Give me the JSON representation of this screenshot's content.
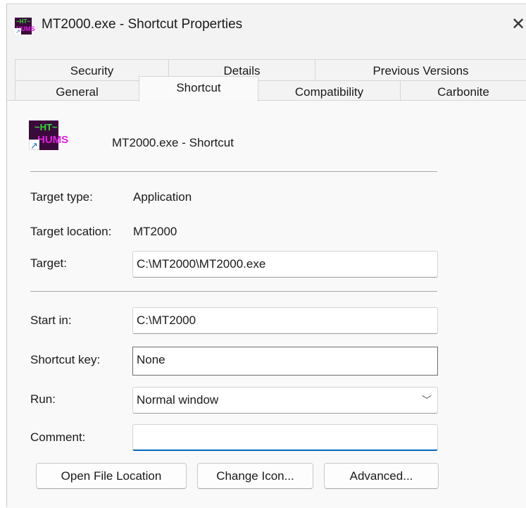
{
  "window": {
    "title": "MT2000.exe - Shortcut Properties",
    "close_glyph": "✕",
    "app_icon": {
      "name": "ht-hums-app-icon",
      "line1": "~HT~",
      "line2": "HUMS",
      "arrow": "↗"
    }
  },
  "tabs": {
    "row1": [
      {
        "label": "Security"
      },
      {
        "label": "Details"
      },
      {
        "label": "Previous Versions"
      }
    ],
    "row2": [
      {
        "label": "General"
      },
      {
        "label": "Shortcut",
        "active": true
      },
      {
        "label": "Compatibility"
      },
      {
        "label": "Carbonite"
      }
    ]
  },
  "shortcut": {
    "name": "MT2000.exe - Shortcut",
    "target_type_label": "Target type:",
    "target_type_value": "Application",
    "target_location_label": "Target location:",
    "target_location_value": "MT2000",
    "target_label": "Target:",
    "target_value": "C:\\MT2000\\MT2000.exe",
    "start_in_label": "Start in:",
    "start_in_value": "C:\\MT2000",
    "shortcut_key_label": "Shortcut key:",
    "shortcut_key_value": "None",
    "run_label": "Run:",
    "run_value": "Normal window",
    "comment_label": "Comment:",
    "comment_value": ""
  },
  "buttons": {
    "open_file_location": "Open File Location",
    "change_icon": "Change Icon...",
    "advanced": "Advanced..."
  },
  "colors": {
    "accent": "#0067c0",
    "icon_bg": "#3b0a3b",
    "icon_green": "#2fe02f",
    "icon_magenta": "#e01fe0"
  }
}
